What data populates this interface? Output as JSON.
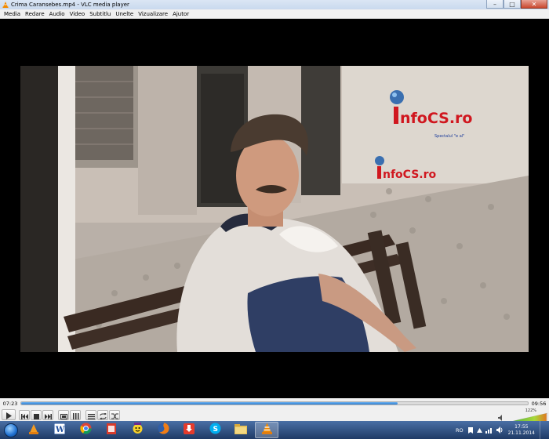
{
  "window": {
    "title": "Crima Caransebes.mp4 - VLC media player",
    "icon": "vlc-cone-icon",
    "controls": [
      "minimize-icon",
      "maximize-icon",
      "close-icon"
    ]
  },
  "menu": {
    "items": [
      "Media",
      "Redare",
      "Audio",
      "Video",
      "Subtitlu",
      "Unelte",
      "Vizualizare",
      "Ajutor"
    ]
  },
  "video": {
    "watermark_large": "nfoCS.ro",
    "watermark_tagline": "Spectalul \"e al\"",
    "watermark_small": "nfoCS.ro"
  },
  "playback": {
    "elapsed": "07:23",
    "total": "09:56",
    "progress_fraction": 0.743,
    "volume": "122%"
  },
  "control_buttons": [
    "play-icon",
    "previous-icon",
    "stop-icon",
    "next-icon",
    "fullscreen-icon",
    "extended-settings-icon",
    "playlist-icon",
    "loop-icon",
    "shuffle-icon"
  ],
  "taskbar": {
    "apps": [
      "vlc-taskbar-icon",
      "word-icon",
      "chrome-icon",
      "pdf-icon",
      "yahoo-messenger-icon",
      "firefox-icon",
      "download-icon",
      "skype-icon",
      "folder-icon",
      "vlc-icon"
    ],
    "language": "RO",
    "time": "17:55",
    "date": "21.11.2014"
  },
  "colors": {
    "accent_blue": "#2f7fd0",
    "watermark_red": "#d0171f",
    "watermark_blue": "#1a3a9a"
  }
}
